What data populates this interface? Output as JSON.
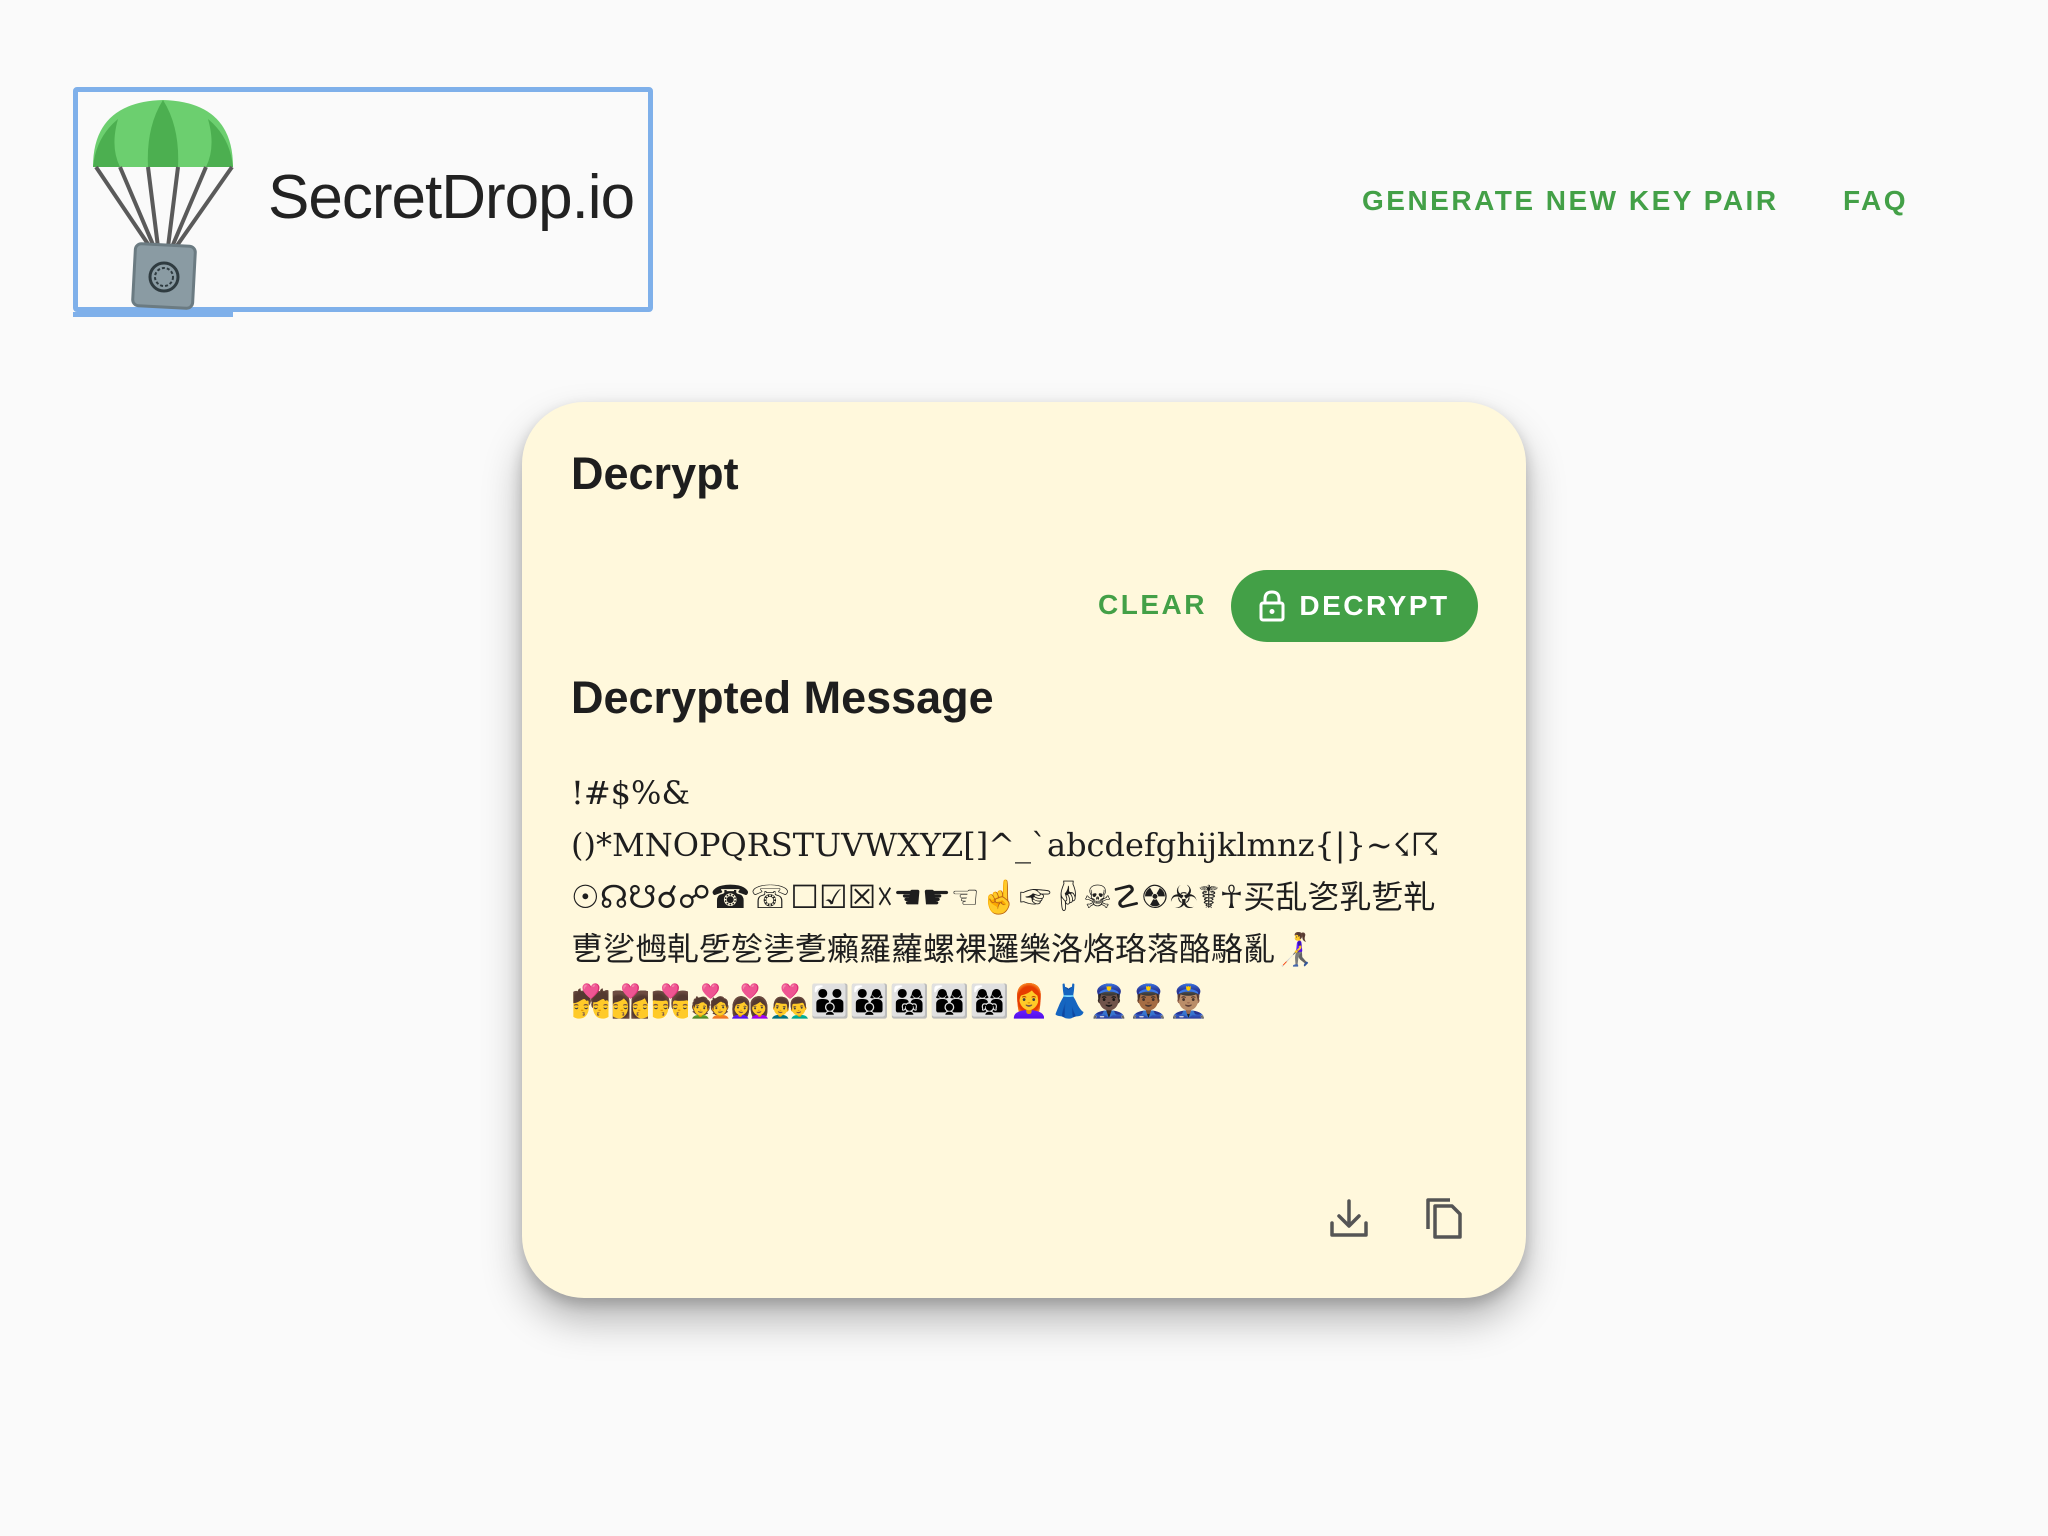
{
  "header": {
    "logo_text": "SecretDrop.io",
    "nav": {
      "generate_label": "GENERATE NEW KEY PAIR",
      "faq_label": "FAQ"
    }
  },
  "card": {
    "title": "Decrypt",
    "clear_label": "CLEAR",
    "decrypt_label": "DECRYPT",
    "section_title": "Decrypted Message",
    "message_lines": [
      "!#$%&",
      "()*MNOPQRSTUVWXYZ[]^_`abcdefghijklmnz{|}~☇☈",
      "☉☊☋☌☍☎☏☐☑☒☓☚☛☜☝☞☟☠☡☢☣☤☥买乱乲乳乴乵",
      "乶乷乸乹乺乻乼乽癩羅蘿螺裸邏樂洛烙珞落酪駱亂👩‍🦯",
      "💏👩‍❤️‍💋‍👩👨‍❤️‍💋‍👨💑👩‍❤️‍👩👨‍❤️‍👨👪👨‍👩‍👦👨‍👩‍👧👩‍👩‍👦👩‍👩‍👧👩‍🦰👗👮🏿‍♂️👮🏾‍♂️👮🏽‍♂️"
    ],
    "icons": {
      "lock": "lock-icon",
      "download": "download-icon",
      "copy": "copy-icon"
    }
  },
  "colors": {
    "accent": "#43a047",
    "card_bg": "#fff8dc",
    "page_bg": "#fafafa",
    "focus_ring": "#7fb0ea"
  }
}
